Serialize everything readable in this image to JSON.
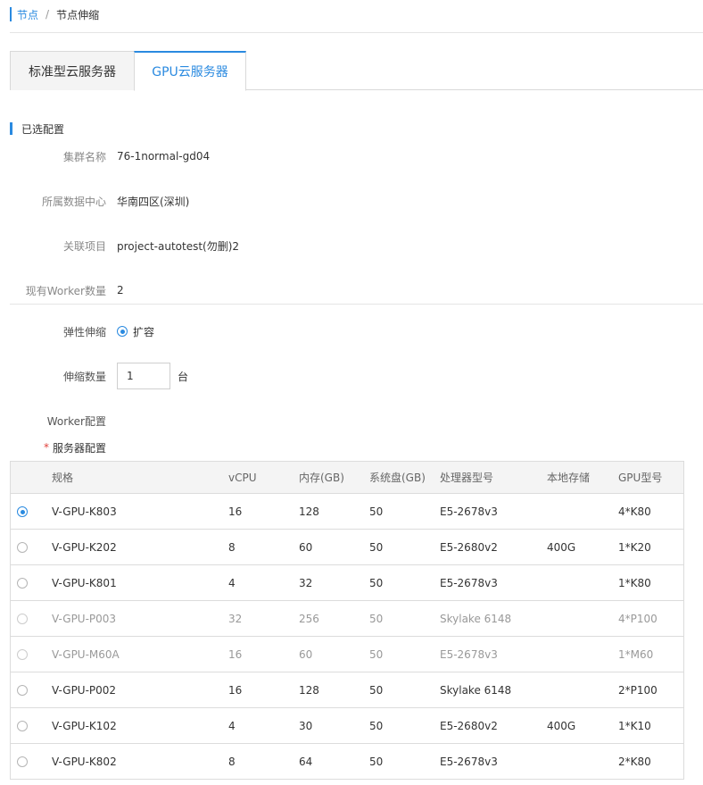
{
  "breadcrumb": {
    "root": "节点",
    "sep": "/",
    "current": "节点伸缩"
  },
  "tabs": [
    {
      "label": "标准型云服务器"
    },
    {
      "label": "GPU云服务器"
    }
  ],
  "selected_config": {
    "title": "已选配置",
    "fields": [
      {
        "label": "集群名称",
        "value": "76-1normal-gd04"
      },
      {
        "label": "所属数据中心",
        "value": "华南四区(深圳)"
      },
      {
        "label": "关联项目",
        "value": "project-autotest(勿删)2"
      },
      {
        "label": "现有Worker数量",
        "value": "2"
      }
    ]
  },
  "scaling": {
    "label": "弹性伸缩",
    "option": "扩容",
    "qty_label": "伸缩数量",
    "qty_value": "1",
    "qty_unit": "台"
  },
  "worker_config_label": "Worker配置",
  "server_config_label": "服务器配置",
  "required_mark": "*",
  "table": {
    "headers": [
      "规格",
      "vCPU",
      "内存(GB)",
      "系统盘(GB)",
      "处理器型号",
      "本地存储",
      "GPU型号"
    ],
    "rows": [
      {
        "spec": "V-GPU-K803",
        "vcpu": "16",
        "mem": "128",
        "disk": "50",
        "cpu": "E5-2678v3",
        "store": "",
        "gpu": "4*K80"
      },
      {
        "spec": "V-GPU-K202",
        "vcpu": "8",
        "mem": "60",
        "disk": "50",
        "cpu": "E5-2680v2",
        "store": "400G",
        "gpu": "1*K20"
      },
      {
        "spec": "V-GPU-K801",
        "vcpu": "4",
        "mem": "32",
        "disk": "50",
        "cpu": "E5-2678v3",
        "store": "",
        "gpu": "1*K80"
      },
      {
        "spec": "V-GPU-P003",
        "vcpu": "32",
        "mem": "256",
        "disk": "50",
        "cpu": "Skylake 6148",
        "store": "",
        "gpu": "4*P100"
      },
      {
        "spec": "V-GPU-M60A",
        "vcpu": "16",
        "mem": "60",
        "disk": "50",
        "cpu": "E5-2678v3",
        "store": "",
        "gpu": "1*M60"
      },
      {
        "spec": "V-GPU-P002",
        "vcpu": "16",
        "mem": "128",
        "disk": "50",
        "cpu": "Skylake 6148",
        "store": "",
        "gpu": "2*P100"
      },
      {
        "spec": "V-GPU-K102",
        "vcpu": "4",
        "mem": "30",
        "disk": "50",
        "cpu": "E5-2680v2",
        "store": "400G",
        "gpu": "1*K10"
      },
      {
        "spec": "V-GPU-K802",
        "vcpu": "8",
        "mem": "64",
        "disk": "50",
        "cpu": "E5-2678v3",
        "store": "",
        "gpu": "2*K80"
      }
    ]
  },
  "colors": {
    "accent": "#2a8ae0",
    "required": "#e0403b"
  }
}
